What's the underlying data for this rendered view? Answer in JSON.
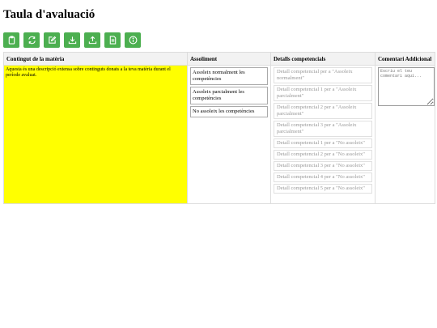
{
  "page": {
    "title": "Taula d'avaluació"
  },
  "toolbar": {
    "buttons": [
      {
        "icon": "clipboard-icon"
      },
      {
        "icon": "refresh-icon"
      },
      {
        "icon": "edit-icon"
      },
      {
        "icon": "download-icon"
      },
      {
        "icon": "upload-icon"
      },
      {
        "icon": "document-icon"
      },
      {
        "icon": "info-icon"
      }
    ],
    "button_color": "#4caf50"
  },
  "table": {
    "headers": {
      "content": "Contingut de la matèria",
      "achievement": "Assoliment",
      "details": "Detalls competencials",
      "comment": "Comentari Addicional"
    },
    "content_text": "Aquesta és una descripció extensa sobre continguts donats a la teva matèria durant el període avaluat.",
    "content_bg": "#ffff00",
    "levels": [
      "Assoleix normalment les competències",
      "Assoleix parcialment les competències",
      "No assoleix les competències"
    ],
    "details": [
      "Detall competencial per a \"Assoleix normalment\"",
      "Detall competencial 1 per a \"Assoleix parcialment\"",
      "Detall competencial 2 per a \"Assoleix parcialment\"",
      "Detall competencial 3 per a \"Assoleix parcialment\"",
      "Detall competencial 1 per a \"No assoleix\"",
      "Detall competencial 2 per a \"No assoleix\"",
      "Detall competencial 3 per a \"No assoleix\"",
      "Detall competencial 4 per a \"No assoleix\"",
      "Detall competencial 5 per a \"No assoleix\""
    ],
    "comment_placeholder": "Escriu el teu comentari aquí..."
  }
}
